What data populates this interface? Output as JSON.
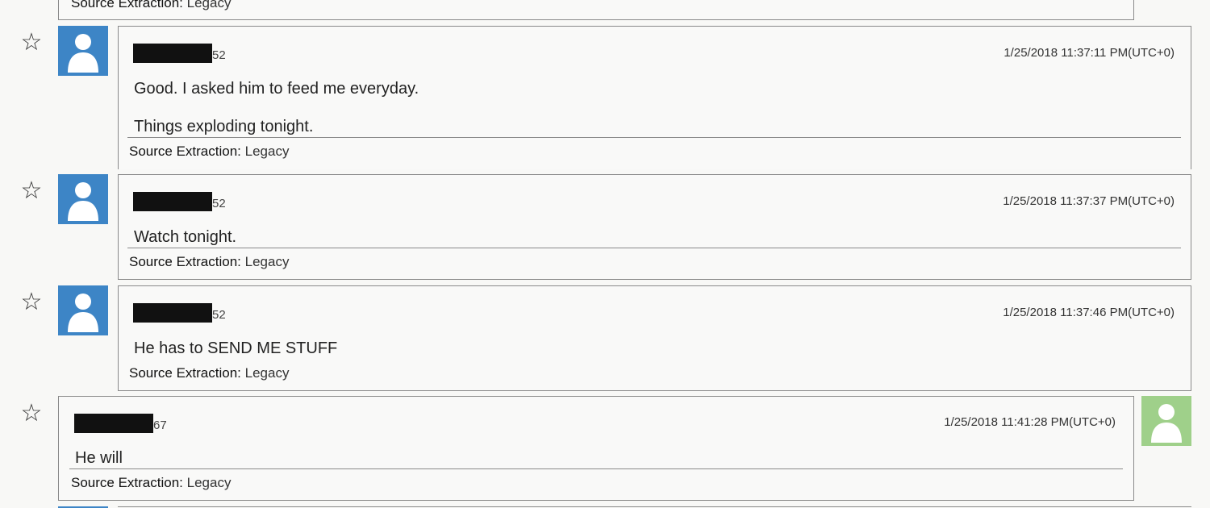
{
  "source_label": "Source Extraction:",
  "colors": {
    "incoming_avatar": "#3d85c6",
    "outgoing_avatar": "#9fd08a",
    "border": "#8a8a8a",
    "redaction": "#111111"
  },
  "messages": [
    {
      "sender_suffix": "52",
      "timestamp": "1/25/2018 11:37:11 PM(UTC+0)",
      "lines": [
        "Good. I asked him to feed me everyday.",
        "Things exploding tonight."
      ],
      "source_value": "Legacy",
      "direction": "incoming"
    },
    {
      "sender_suffix": "52",
      "timestamp": "1/25/2018 11:37:37 PM(UTC+0)",
      "lines": [
        "Watch tonight."
      ],
      "source_value": "Legacy",
      "direction": "incoming"
    },
    {
      "sender_suffix": "52",
      "timestamp": "1/25/2018 11:37:46 PM(UTC+0)",
      "lines": [
        "He has to SEND ME STUFF"
      ],
      "source_value": "Legacy",
      "direction": "incoming"
    },
    {
      "sender_suffix": "67",
      "timestamp": "1/25/2018 11:41:28 PM(UTC+0)",
      "lines": [
        "He will"
      ],
      "source_value": "Legacy",
      "direction": "outgoing"
    }
  ],
  "top_partial": {
    "source_value": "Legacy"
  }
}
